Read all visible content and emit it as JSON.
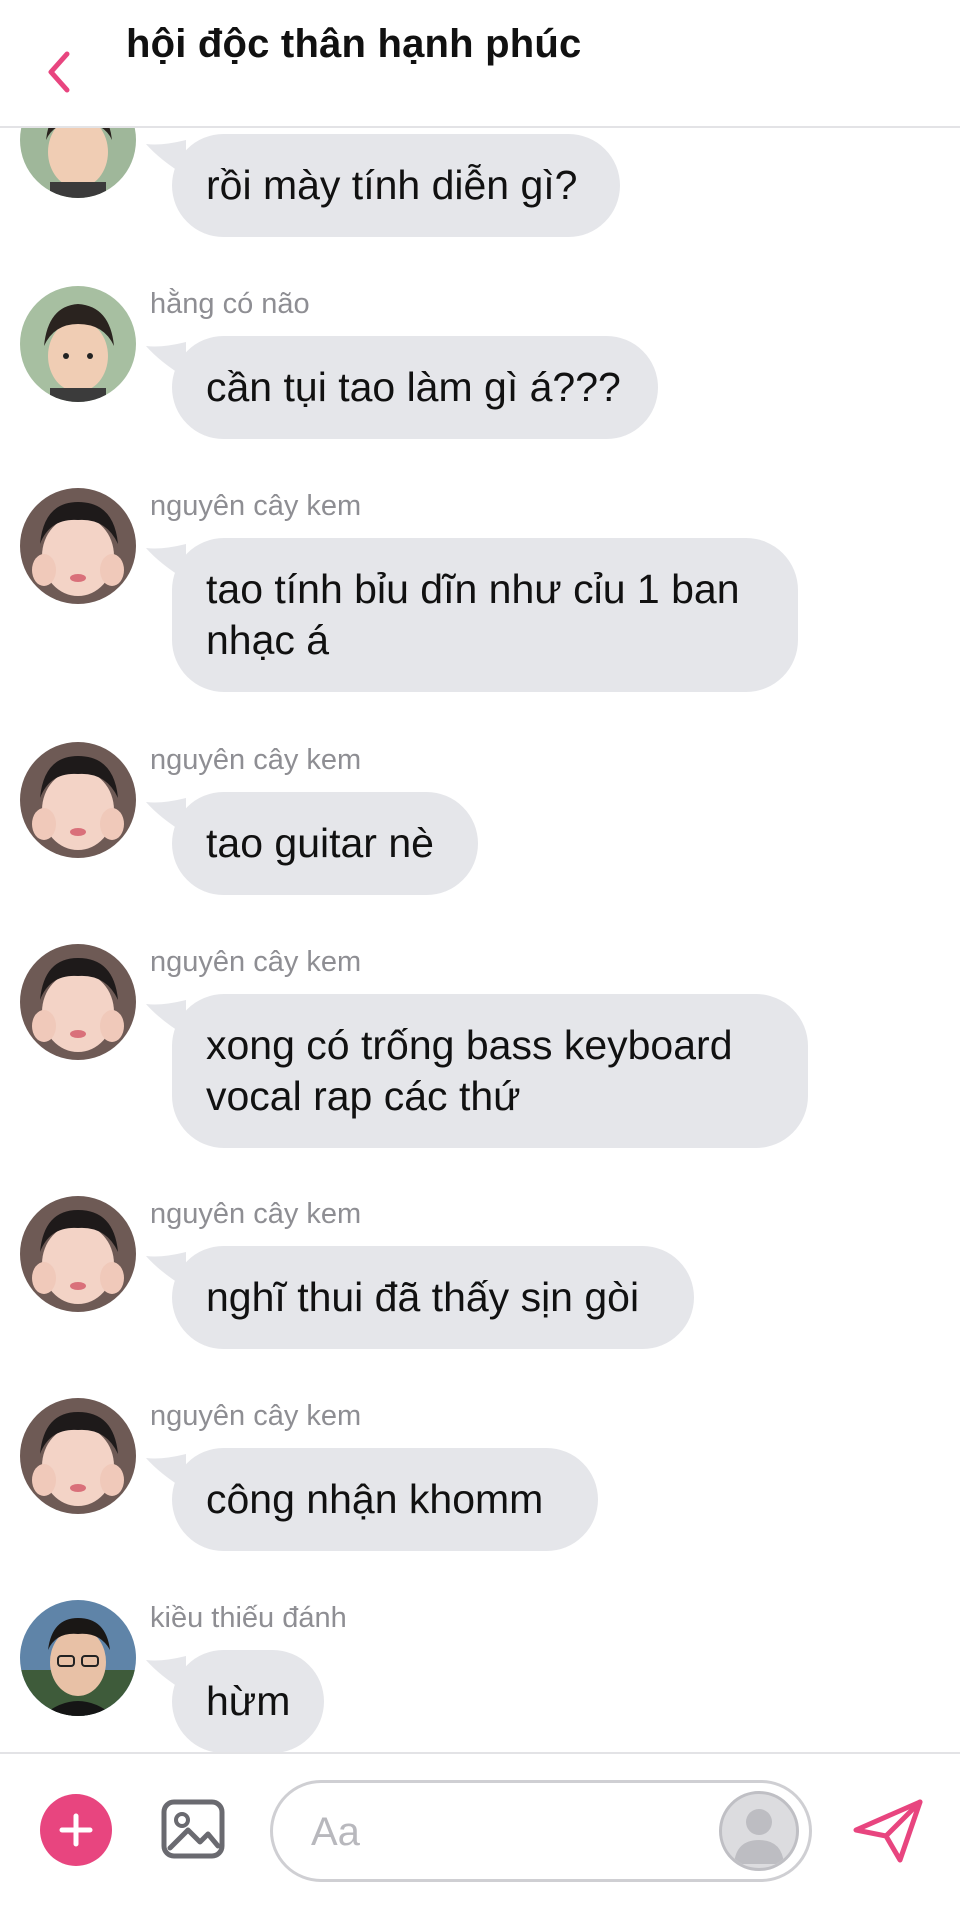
{
  "header": {
    "title": "hội độc thân hạnh phúc"
  },
  "messages": [
    {
      "sender": "",
      "text": "rồi mày tính diễn gì?",
      "avatar": "avatar-boy-green"
    },
    {
      "sender": "hằng có não",
      "text": "cần tụi tao làm gì á???",
      "avatar": "avatar-boy-green"
    },
    {
      "sender": "nguyên cây kem",
      "text": "tao tính bỉu dĩn như cỉu 1 ban nhạc á",
      "avatar": "avatar-face-squish"
    },
    {
      "sender": "nguyên cây kem",
      "text": "tao guitar nè",
      "avatar": "avatar-face-squish"
    },
    {
      "sender": "nguyên cây kem",
      "text": "xong có trống bass keyboard vocal rap các thứ",
      "avatar": "avatar-face-squish"
    },
    {
      "sender": "nguyên cây kem",
      "text": "nghĩ thui đã thấy sịn gòi",
      "avatar": "avatar-face-squish"
    },
    {
      "sender": "nguyên cây kem",
      "text": "công nhận khomm",
      "avatar": "avatar-face-squish"
    },
    {
      "sender": "kiều thiếu đánh",
      "text": "hừm",
      "avatar": "avatar-boy-glasses"
    }
  ],
  "composer": {
    "placeholder": "Aa"
  },
  "colors": {
    "accent": "#e8457f",
    "bubble": "#e5e6ea",
    "muted": "#8e8e93"
  },
  "icons": {
    "back": "chevron-left-icon",
    "add": "plus-icon",
    "image": "image-icon",
    "send": "send-icon"
  }
}
